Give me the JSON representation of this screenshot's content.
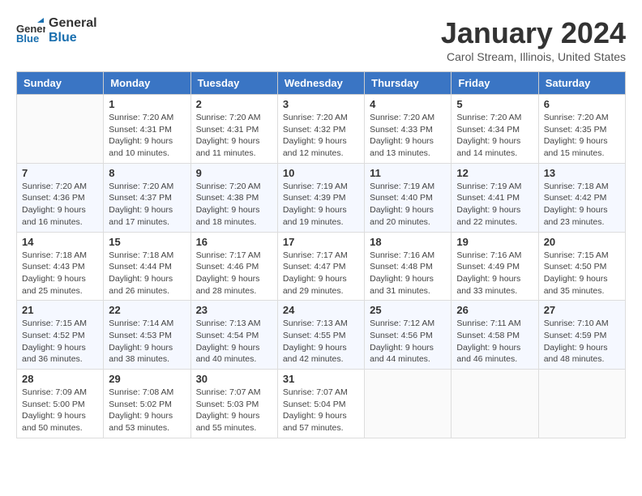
{
  "logo": {
    "general": "General",
    "blue": "Blue"
  },
  "header": {
    "month": "January 2024",
    "location": "Carol Stream, Illinois, United States"
  },
  "days_of_week": [
    "Sunday",
    "Monday",
    "Tuesday",
    "Wednesday",
    "Thursday",
    "Friday",
    "Saturday"
  ],
  "weeks": [
    [
      {
        "day": "",
        "sunrise": "",
        "sunset": "",
        "daylight": ""
      },
      {
        "day": "1",
        "sunrise": "Sunrise: 7:20 AM",
        "sunset": "Sunset: 4:31 PM",
        "daylight": "Daylight: 9 hours and 10 minutes."
      },
      {
        "day": "2",
        "sunrise": "Sunrise: 7:20 AM",
        "sunset": "Sunset: 4:31 PM",
        "daylight": "Daylight: 9 hours and 11 minutes."
      },
      {
        "day": "3",
        "sunrise": "Sunrise: 7:20 AM",
        "sunset": "Sunset: 4:32 PM",
        "daylight": "Daylight: 9 hours and 12 minutes."
      },
      {
        "day": "4",
        "sunrise": "Sunrise: 7:20 AM",
        "sunset": "Sunset: 4:33 PM",
        "daylight": "Daylight: 9 hours and 13 minutes."
      },
      {
        "day": "5",
        "sunrise": "Sunrise: 7:20 AM",
        "sunset": "Sunset: 4:34 PM",
        "daylight": "Daylight: 9 hours and 14 minutes."
      },
      {
        "day": "6",
        "sunrise": "Sunrise: 7:20 AM",
        "sunset": "Sunset: 4:35 PM",
        "daylight": "Daylight: 9 hours and 15 minutes."
      }
    ],
    [
      {
        "day": "7",
        "sunrise": "Sunrise: 7:20 AM",
        "sunset": "Sunset: 4:36 PM",
        "daylight": "Daylight: 9 hours and 16 minutes."
      },
      {
        "day": "8",
        "sunrise": "Sunrise: 7:20 AM",
        "sunset": "Sunset: 4:37 PM",
        "daylight": "Daylight: 9 hours and 17 minutes."
      },
      {
        "day": "9",
        "sunrise": "Sunrise: 7:20 AM",
        "sunset": "Sunset: 4:38 PM",
        "daylight": "Daylight: 9 hours and 18 minutes."
      },
      {
        "day": "10",
        "sunrise": "Sunrise: 7:19 AM",
        "sunset": "Sunset: 4:39 PM",
        "daylight": "Daylight: 9 hours and 19 minutes."
      },
      {
        "day": "11",
        "sunrise": "Sunrise: 7:19 AM",
        "sunset": "Sunset: 4:40 PM",
        "daylight": "Daylight: 9 hours and 20 minutes."
      },
      {
        "day": "12",
        "sunrise": "Sunrise: 7:19 AM",
        "sunset": "Sunset: 4:41 PM",
        "daylight": "Daylight: 9 hours and 22 minutes."
      },
      {
        "day": "13",
        "sunrise": "Sunrise: 7:18 AM",
        "sunset": "Sunset: 4:42 PM",
        "daylight": "Daylight: 9 hours and 23 minutes."
      }
    ],
    [
      {
        "day": "14",
        "sunrise": "Sunrise: 7:18 AM",
        "sunset": "Sunset: 4:43 PM",
        "daylight": "Daylight: 9 hours and 25 minutes."
      },
      {
        "day": "15",
        "sunrise": "Sunrise: 7:18 AM",
        "sunset": "Sunset: 4:44 PM",
        "daylight": "Daylight: 9 hours and 26 minutes."
      },
      {
        "day": "16",
        "sunrise": "Sunrise: 7:17 AM",
        "sunset": "Sunset: 4:46 PM",
        "daylight": "Daylight: 9 hours and 28 minutes."
      },
      {
        "day": "17",
        "sunrise": "Sunrise: 7:17 AM",
        "sunset": "Sunset: 4:47 PM",
        "daylight": "Daylight: 9 hours and 29 minutes."
      },
      {
        "day": "18",
        "sunrise": "Sunrise: 7:16 AM",
        "sunset": "Sunset: 4:48 PM",
        "daylight": "Daylight: 9 hours and 31 minutes."
      },
      {
        "day": "19",
        "sunrise": "Sunrise: 7:16 AM",
        "sunset": "Sunset: 4:49 PM",
        "daylight": "Daylight: 9 hours and 33 minutes."
      },
      {
        "day": "20",
        "sunrise": "Sunrise: 7:15 AM",
        "sunset": "Sunset: 4:50 PM",
        "daylight": "Daylight: 9 hours and 35 minutes."
      }
    ],
    [
      {
        "day": "21",
        "sunrise": "Sunrise: 7:15 AM",
        "sunset": "Sunset: 4:52 PM",
        "daylight": "Daylight: 9 hours and 36 minutes."
      },
      {
        "day": "22",
        "sunrise": "Sunrise: 7:14 AM",
        "sunset": "Sunset: 4:53 PM",
        "daylight": "Daylight: 9 hours and 38 minutes."
      },
      {
        "day": "23",
        "sunrise": "Sunrise: 7:13 AM",
        "sunset": "Sunset: 4:54 PM",
        "daylight": "Daylight: 9 hours and 40 minutes."
      },
      {
        "day": "24",
        "sunrise": "Sunrise: 7:13 AM",
        "sunset": "Sunset: 4:55 PM",
        "daylight": "Daylight: 9 hours and 42 minutes."
      },
      {
        "day": "25",
        "sunrise": "Sunrise: 7:12 AM",
        "sunset": "Sunset: 4:56 PM",
        "daylight": "Daylight: 9 hours and 44 minutes."
      },
      {
        "day": "26",
        "sunrise": "Sunrise: 7:11 AM",
        "sunset": "Sunset: 4:58 PM",
        "daylight": "Daylight: 9 hours and 46 minutes."
      },
      {
        "day": "27",
        "sunrise": "Sunrise: 7:10 AM",
        "sunset": "Sunset: 4:59 PM",
        "daylight": "Daylight: 9 hours and 48 minutes."
      }
    ],
    [
      {
        "day": "28",
        "sunrise": "Sunrise: 7:09 AM",
        "sunset": "Sunset: 5:00 PM",
        "daylight": "Daylight: 9 hours and 50 minutes."
      },
      {
        "day": "29",
        "sunrise": "Sunrise: 7:08 AM",
        "sunset": "Sunset: 5:02 PM",
        "daylight": "Daylight: 9 hours and 53 minutes."
      },
      {
        "day": "30",
        "sunrise": "Sunrise: 7:07 AM",
        "sunset": "Sunset: 5:03 PM",
        "daylight": "Daylight: 9 hours and 55 minutes."
      },
      {
        "day": "31",
        "sunrise": "Sunrise: 7:07 AM",
        "sunset": "Sunset: 5:04 PM",
        "daylight": "Daylight: 9 hours and 57 minutes."
      },
      {
        "day": "",
        "sunrise": "",
        "sunset": "",
        "daylight": ""
      },
      {
        "day": "",
        "sunrise": "",
        "sunset": "",
        "daylight": ""
      },
      {
        "day": "",
        "sunrise": "",
        "sunset": "",
        "daylight": ""
      }
    ]
  ]
}
